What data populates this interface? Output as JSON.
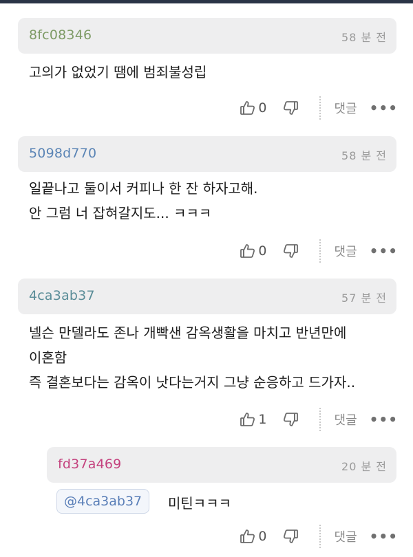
{
  "comments": [
    {
      "username": "8fc08346",
      "user_color": "#7e9b66",
      "time": "58 분 전",
      "lines": [
        "고의가 없었기 땜에 범죄불성립"
      ],
      "likes": "0",
      "reply_label": "댓글"
    },
    {
      "username": "5098d770",
      "user_color": "#5a84b5",
      "time": "58 분 전",
      "lines": [
        "일끝나고 둘이서 커피나 한 잔 하자고해.",
        "안 그럼 너 잡혀갈지도... ㅋㅋㅋ"
      ],
      "likes": "0",
      "reply_label": "댓글"
    },
    {
      "username": "4ca3ab37",
      "user_color": "#5a8d98",
      "time": "57 분 전",
      "lines": [
        "넬슨 만델라도 존나 개빡샌 감옥생활을 마치고 반년만에",
        "이혼함",
        "즉 결혼보다는 감옥이 낫다는거지 그냥 순응하고 드가자.."
      ],
      "likes": "1",
      "reply_label": "댓글"
    },
    {
      "username": "fd37a469",
      "user_color": "#c4427e",
      "time": "20 분 전",
      "mention": "@4ca3ab37",
      "text": "미틴ㅋㅋㅋ",
      "likes": "0",
      "reply_label": "댓글"
    }
  ],
  "icons": {
    "like": "thumbs-up-icon",
    "dislike": "thumbs-down-icon",
    "more": "more-dots-icon"
  }
}
